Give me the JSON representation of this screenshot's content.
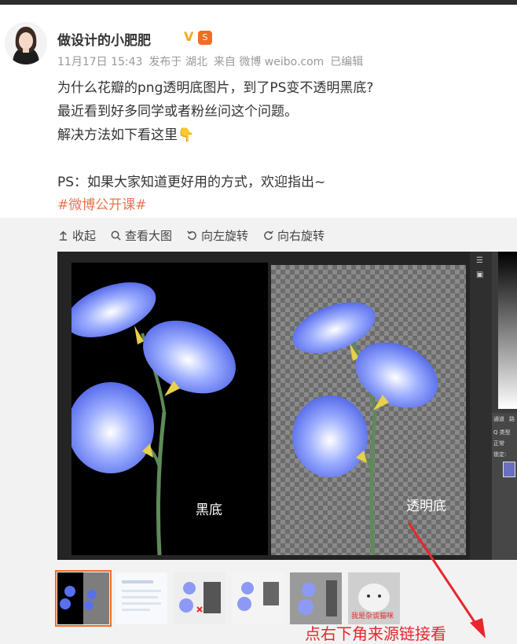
{
  "post": {
    "username": "做设计的小肥肥",
    "verified_mark": "V",
    "badge_text": "S",
    "meta": {
      "date": "11月17日 15:43",
      "location": "发布于 湖北",
      "source": "来自 微博 weibo.com",
      "edited": "已编辑"
    },
    "lines": [
      "为什么花瓣的png透明底图片，到了PS变不透明黑底?",
      "最近看到好多同学或者粉丝问这个问题。",
      "解决方法如下看这里👇",
      "PS：如果大家知道更好用的方式，欢迎指出~"
    ],
    "hashtag": "#微博公开课#"
  },
  "toolbar": {
    "collapse": "收起",
    "view_large": "查看大图",
    "rotate_left": "向左旋转",
    "rotate_right": "向右旋转"
  },
  "image_labels": {
    "black": "黑底",
    "transparent": "透明底"
  },
  "ps_panel": {
    "tab1": "通道",
    "tab2": "路",
    "filter": "Q 类型",
    "mode": "正常",
    "lock": "锁定:"
  },
  "thumb_caption": "我是杂谈猫咪",
  "annotation": "点右下角来源链接看",
  "colors": {
    "accent": "#f36d22",
    "hashtag": "#eb7350",
    "annotation": "#e8262c",
    "flower": "#5a6ff0"
  }
}
